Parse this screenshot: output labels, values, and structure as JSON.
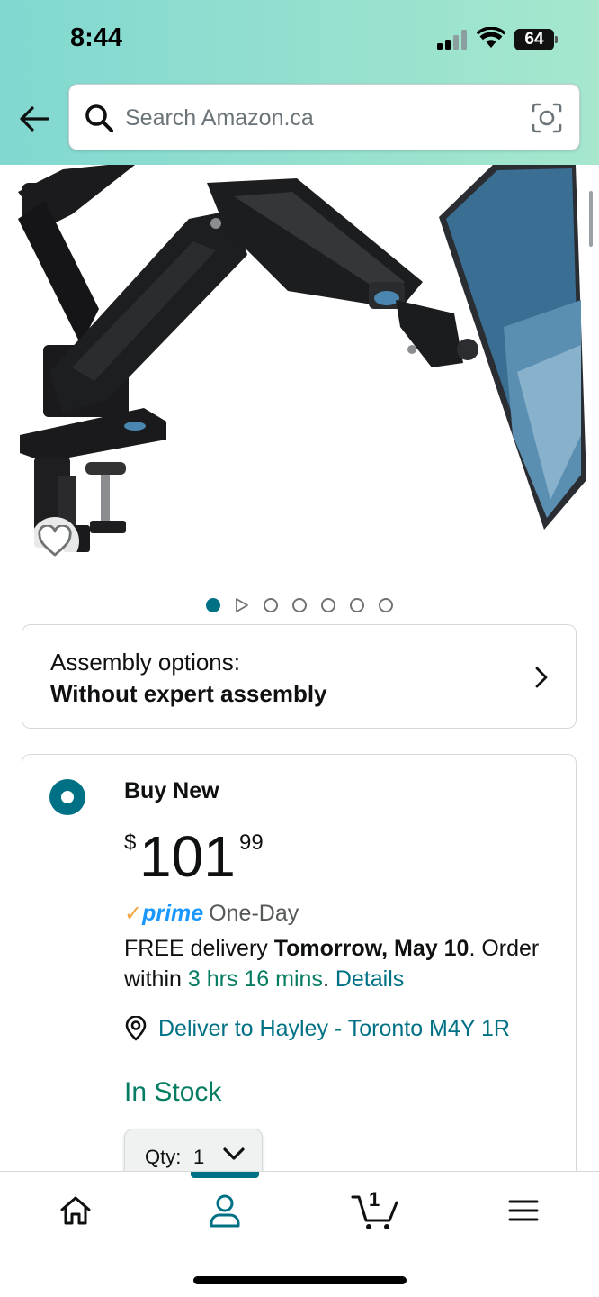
{
  "status_bar": {
    "time": "8:44",
    "battery": "64"
  },
  "search": {
    "placeholder": "Search Amazon.ca",
    "value": ""
  },
  "colors": {
    "accent": "#007185",
    "green": "#067d62",
    "prime_blue": "#1a98ff",
    "prime_check": "#f2a742",
    "header_start": "#81d8d0",
    "header_end": "#a6e7ce"
  },
  "gallery": {
    "image_count": 7,
    "active_index": 0,
    "has_video": true
  },
  "assembly": {
    "label": "Assembly options:",
    "value": "Without expert assembly"
  },
  "buybox": {
    "title": "Buy New",
    "price_symbol": "$",
    "price_whole": "101",
    "price_fraction": "99",
    "prime_check": "✓",
    "prime_word": "prime",
    "prime_speed": "One-Day",
    "delivery_prefix": "FREE delivery ",
    "delivery_date": "Tomorrow, May 10",
    "delivery_mid": ". Order within ",
    "delivery_countdown": "3 hrs 16 mins",
    "delivery_suffix": ". ",
    "details_link": "Details",
    "deliver_to": "Deliver to Hayley - Toronto M4Y 1R",
    "stock": "In Stock",
    "qty_label": "Qty:",
    "qty_value": "1"
  },
  "bottom_nav": {
    "items": [
      "home-icon",
      "account-icon",
      "cart-icon",
      "menu-icon"
    ],
    "active": "account-icon",
    "cart_count": "1"
  }
}
